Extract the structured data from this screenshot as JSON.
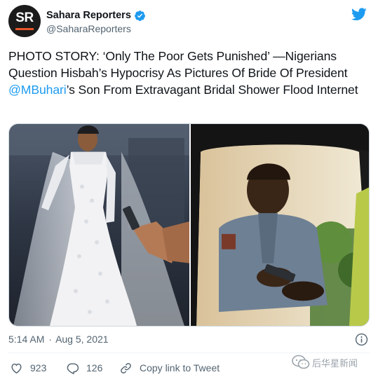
{
  "author": {
    "avatar_text": "SR",
    "display_name": "Sahara Reporters",
    "handle": "@SaharaReporters",
    "verified": true
  },
  "tweet": {
    "text_before": "PHOTO STORY: ‘Only The Poor Gets Punished’ —Nigerians Question Hisbah’s Hypocrisy As Pictures Of Bride Of President ",
    "mention": "@MBuhari",
    "text_after": "’s Son From Extravagant Bridal Shower Flood Internet",
    "time": "5:14 AM",
    "separator": "·",
    "date": "Aug 5, 2021"
  },
  "actions": {
    "like_count": "923",
    "reply_count": "126",
    "copy_link_label": "Copy link to Tweet"
  },
  "watermark": {
    "text": "后华星新闻"
  },
  "icons": {
    "app": "twitter-bird-icon",
    "verified": "verified-badge-icon",
    "info": "info-icon",
    "like": "heart-icon",
    "reply": "reply-icon",
    "copy": "link-icon",
    "watermark": "wechat-icon"
  },
  "colors": {
    "accent": "#1d9bf0",
    "text": "#0f1419",
    "secondary_text": "#536471",
    "brand_orange": "#e8572b"
  }
}
